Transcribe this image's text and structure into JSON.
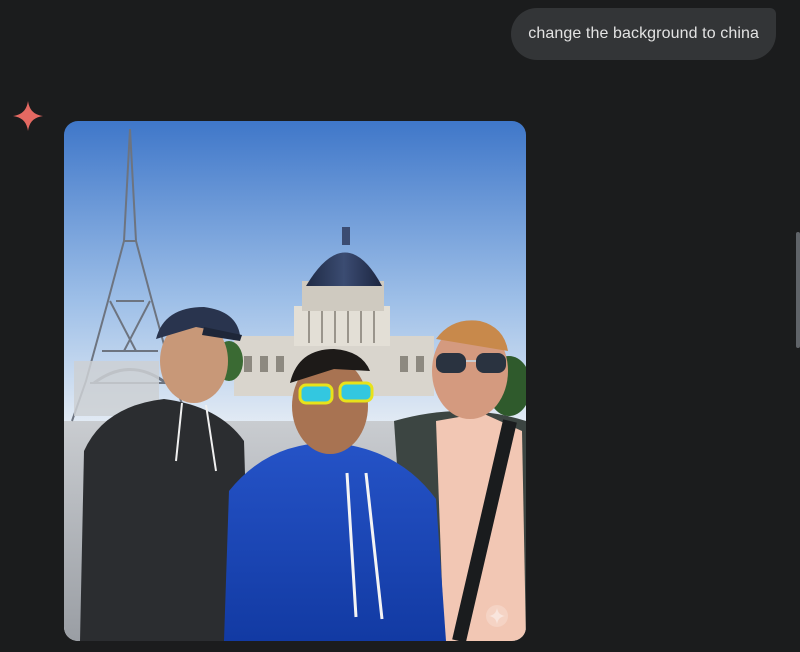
{
  "chat": {
    "user_message": "change the background to china"
  },
  "response": {
    "icon": "sparkle-icon",
    "image_icon": "sparkle-watermark-icon"
  },
  "colors": {
    "page_background": "#1b1c1d",
    "user_bubble": "#333537",
    "user_text": "#e3e3e3",
    "sparkle_accent": "#e46962"
  }
}
